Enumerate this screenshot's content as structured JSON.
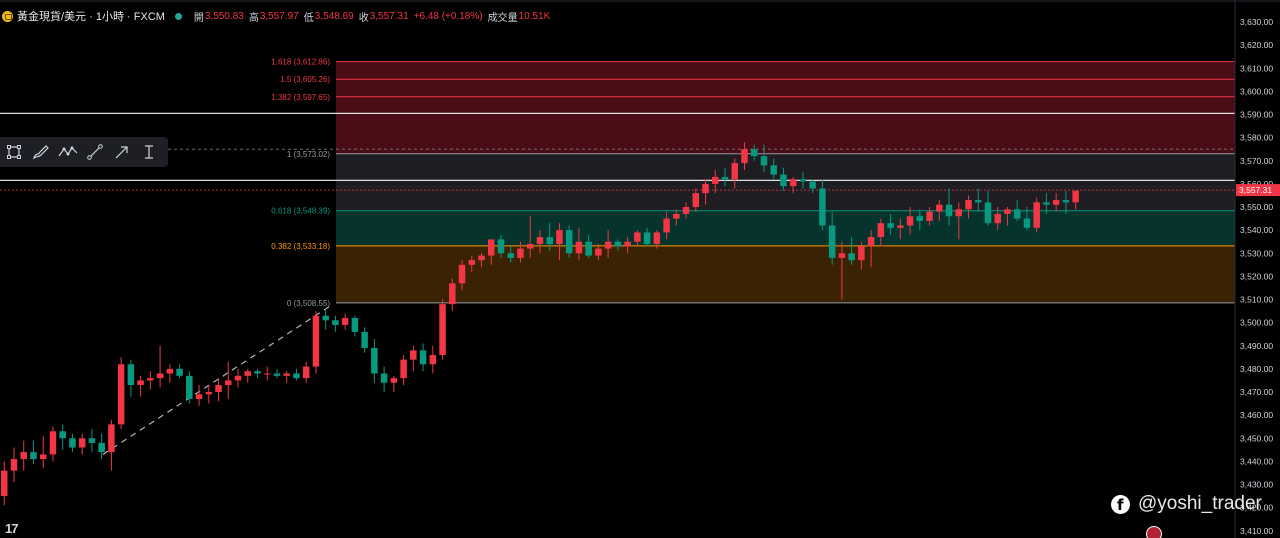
{
  "header": {
    "symbol": "黃金現貨/美元 · 1小時 · FXCM",
    "open_label": "開",
    "open": "3,550.83",
    "high_label": "高",
    "high": "3,557.97",
    "low_label": "低",
    "low": "3,548.69",
    "close_label": "收",
    "close": "3,557.31",
    "change": "+6.48 (+0.18%)",
    "volume_label": "成交量",
    "volume": "10.51K"
  },
  "price_axis": {
    "labels": [
      "3,630.00",
      "3,620.00",
      "3,610.00",
      "3,600.00",
      "3,590.00",
      "3,580.00",
      "3,570.00",
      "3,560.00",
      "3,550.00",
      "3,540.00",
      "3,530.00",
      "3,520.00",
      "3,510.00",
      "3,500.00",
      "3,490.00",
      "3,480.00",
      "3,470.00",
      "3,460.00",
      "3,450.00",
      "3,440.00",
      "3,430.00",
      "3,420.00",
      "3,410.00"
    ],
    "current_price": "3,557.31"
  },
  "colors": {
    "up": "#f23645",
    "down": "#089981",
    "background": "#000000",
    "fib_red": "#f23645",
    "fib_teal": "#089981",
    "fib_orange": "#ff9800",
    "fib_gray": "#9598a1",
    "zone_red": "#4a0d15",
    "zone_dark": "#1e1e22",
    "zone_teal": "#06332c",
    "zone_orange": "#3a2304"
  },
  "toolbar": {
    "tools": [
      "rectangle-tool-icon",
      "brush-tool-icon",
      "path-tool-icon",
      "trend-line-tool-icon",
      "arrow-tool-icon",
      "text-cursor-tool-icon"
    ]
  },
  "watermark": {
    "text": "@yoshi_trader"
  },
  "logo": {
    "text": "17"
  },
  "chart_data": {
    "type": "candlestick",
    "title": "黃金現貨/美元 · 1小時 · FXCM",
    "y_axis_range": [
      3410,
      3632
    ],
    "grid": false,
    "fib_levels": [
      {
        "ratio": "1.618",
        "price": 3612.86,
        "label": "1.618 (3,612.86)"
      },
      {
        "ratio": "1.5",
        "price": 3605.26,
        "label": "1.5 (3,605.26)"
      },
      {
        "ratio": "1.382",
        "price": 3597.65,
        "label": "1.382 (3,597.65)"
      },
      {
        "ratio": "1",
        "price": 3573.02,
        "label": "1 (3,573.02)"
      },
      {
        "ratio": "0.618",
        "price": 3548.39,
        "label": "0.618 (3,548.39)"
      },
      {
        "ratio": "0.382",
        "price": 3533.18,
        "label": "0.382 (3,533.18)"
      },
      {
        "ratio": "0",
        "price": 3508.55,
        "label": "0 (3,508.55)"
      }
    ],
    "horizontal_lines": [
      3590.5,
      3561.5
    ],
    "dashed_lines": [
      3575.0,
      3557.31
    ],
    "trend_line": {
      "from": 3443,
      "to": 3508
    },
    "candles": [
      [
        3425,
        3440,
        3421,
        3436
      ],
      [
        3436,
        3446,
        3431,
        3441
      ],
      [
        3441,
        3449,
        3436,
        3444
      ],
      [
        3444,
        3449,
        3439,
        3441
      ],
      [
        3441,
        3451,
        3437,
        3443
      ],
      [
        3443,
        3455,
        3440,
        3453
      ],
      [
        3453,
        3456,
        3445,
        3450
      ],
      [
        3450,
        3452,
        3444,
        3446
      ],
      [
        3446,
        3452,
        3443,
        3450
      ],
      [
        3450,
        3454,
        3444,
        3448
      ],
      [
        3448,
        3452,
        3441,
        3444
      ],
      [
        3444,
        3458,
        3436,
        3456
      ],
      [
        3456,
        3485,
        3454,
        3482
      ],
      [
        3482,
        3484,
        3468,
        3473
      ],
      [
        3473,
        3477,
        3468,
        3475
      ],
      [
        3475,
        3479,
        3471,
        3476
      ],
      [
        3476,
        3490,
        3472,
        3478
      ],
      [
        3478,
        3482,
        3474,
        3480
      ],
      [
        3480,
        3482,
        3476,
        3477
      ],
      [
        3477,
        3479,
        3465,
        3467
      ],
      [
        3467,
        3473,
        3464,
        3469
      ],
      [
        3469,
        3473,
        3465,
        3470
      ],
      [
        3470,
        3476,
        3466,
        3473
      ],
      [
        3473,
        3483,
        3467,
        3475
      ],
      [
        3475,
        3480,
        3472,
        3477
      ],
      [
        3477,
        3480,
        3474,
        3479
      ],
      [
        3479,
        3480,
        3476,
        3478
      ],
      [
        3478,
        3481,
        3475,
        3478
      ],
      [
        3478,
        3480,
        3476,
        3477
      ],
      [
        3477,
        3479,
        3474,
        3478
      ],
      [
        3478,
        3480,
        3475,
        3476
      ],
      [
        3476,
        3483,
        3474,
        3481
      ],
      [
        3481,
        3505,
        3478,
        3503
      ],
      [
        3503,
        3506,
        3497,
        3501
      ],
      [
        3501,
        3503,
        3496,
        3499
      ],
      [
        3499,
        3504,
        3497,
        3502
      ],
      [
        3502,
        3503,
        3494,
        3496
      ],
      [
        3496,
        3498,
        3487,
        3489
      ],
      [
        3489,
        3493,
        3474,
        3478
      ],
      [
        3478,
        3481,
        3470,
        3474
      ],
      [
        3474,
        3477,
        3470,
        3476
      ],
      [
        3476,
        3486,
        3473,
        3484
      ],
      [
        3484,
        3490,
        3479,
        3488
      ],
      [
        3488,
        3491,
        3479,
        3482
      ],
      [
        3482,
        3490,
        3478,
        3486
      ],
      [
        3486,
        3510,
        3484,
        3508
      ],
      [
        3508,
        3519,
        3505,
        3517
      ],
      [
        3517,
        3527,
        3514,
        3525
      ],
      [
        3525,
        3529,
        3522,
        3527
      ],
      [
        3527,
        3530,
        3524,
        3529
      ],
      [
        3529,
        3535,
        3525,
        3536
      ],
      [
        3536,
        3538,
        3528,
        3530
      ],
      [
        3530,
        3533,
        3526,
        3528
      ],
      [
        3528,
        3535,
        3526,
        3532
      ],
      [
        3532,
        3546,
        3528,
        3534
      ],
      [
        3534,
        3540,
        3530,
        3537
      ],
      [
        3537,
        3543,
        3531,
        3534
      ],
      [
        3534,
        3543,
        3527,
        3540
      ],
      [
        3540,
        3542,
        3528,
        3530
      ],
      [
        3530,
        3541,
        3527,
        3535
      ],
      [
        3535,
        3538,
        3528,
        3529
      ],
      [
        3529,
        3534,
        3527,
        3532
      ],
      [
        3532,
        3540,
        3528,
        3535
      ],
      [
        3535,
        3536,
        3531,
        3533
      ],
      [
        3533,
        3537,
        3530,
        3535
      ],
      [
        3535,
        3540,
        3533,
        3539
      ],
      [
        3539,
        3541,
        3533,
        3534
      ],
      [
        3534,
        3540,
        3532,
        3539
      ],
      [
        3539,
        3548,
        3536,
        3545
      ],
      [
        3545,
        3549,
        3542,
        3547
      ],
      [
        3547,
        3552,
        3545,
        3550
      ],
      [
        3550,
        3558,
        3548,
        3556
      ],
      [
        3556,
        3562,
        3551,
        3560
      ],
      [
        3560,
        3566,
        3556,
        3563
      ],
      [
        3563,
        3567,
        3559,
        3562
      ],
      [
        3562,
        3571,
        3558,
        3569
      ],
      [
        3569,
        3578,
        3566,
        3575
      ],
      [
        3575,
        3577,
        3570,
        3572
      ],
      [
        3572,
        3577,
        3565,
        3568
      ],
      [
        3568,
        3571,
        3562,
        3564
      ],
      [
        3564,
        3567,
        3557,
        3559
      ],
      [
        3559,
        3563,
        3556,
        3562
      ],
      [
        3562,
        3565,
        3558,
        3561
      ],
      [
        3561,
        3562,
        3556,
        3558
      ],
      [
        3558,
        3562,
        3540,
        3542
      ],
      [
        3542,
        3548,
        3525,
        3528
      ],
      [
        3528,
        3535,
        3510,
        3530
      ],
      [
        3530,
        3537,
        3525,
        3527
      ],
      [
        3527,
        3535,
        3523,
        3533
      ],
      [
        3533,
        3540,
        3524,
        3537
      ],
      [
        3537,
        3545,
        3533,
        3543
      ],
      [
        3543,
        3547,
        3538,
        3541
      ],
      [
        3541,
        3545,
        3536,
        3542
      ],
      [
        3542,
        3550,
        3538,
        3546
      ],
      [
        3546,
        3549,
        3540,
        3544
      ],
      [
        3544,
        3550,
        3542,
        3548
      ],
      [
        3548,
        3553,
        3544,
        3551
      ],
      [
        3551,
        3558,
        3542,
        3546
      ],
      [
        3546,
        3552,
        3536,
        3549
      ],
      [
        3549,
        3555,
        3545,
        3553
      ],
      [
        3553,
        3558,
        3548,
        3552
      ],
      [
        3552,
        3557,
        3542,
        3543
      ],
      [
        3543,
        3550,
        3540,
        3547
      ],
      [
        3547,
        3550,
        3542,
        3549
      ],
      [
        3549,
        3553,
        3544,
        3545
      ],
      [
        3545,
        3550,
        3540,
        3541
      ],
      [
        3541,
        3554,
        3539,
        3552
      ],
      [
        3552,
        3556,
        3547,
        3551
      ],
      [
        3551,
        3556,
        3548,
        3553
      ],
      [
        3553,
        3557,
        3547,
        3552
      ],
      [
        3552,
        3557,
        3549,
        3557
      ]
    ]
  }
}
